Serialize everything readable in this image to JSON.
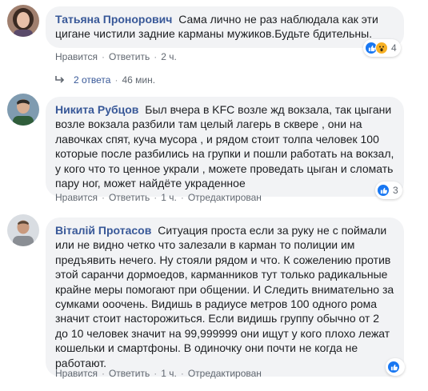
{
  "comments": [
    {
      "author": "Татьяна Пронорович",
      "text": "Сама лично не раз наблюдала как эти цигане чистили задние карманы мужиков.Будьте бдительны.",
      "like_label": "Нравится",
      "reply_label": "Ответить",
      "time": "2 ч.",
      "edited_label": "",
      "reaction_count": "4",
      "reaction_icons": [
        "like-icon",
        "wow-icon"
      ]
    },
    {
      "author": "Никита Рубцов",
      "text": "Был вчера в KFC возле жд вокзала, так цыгани возле вокзала разбили там целый лагерь в сквере , они на лавочках спят, куча мусора , и рядом стоит толпа человек 100 которые после разбились на групки и пошли работать на вокзал, у кого что то ценное украли , можете проведать цыган и сломать пару ног, может найдёте украденное",
      "like_label": "Нравится",
      "reply_label": "Ответить",
      "time": "1 ч.",
      "edited_label": "Отредактирован",
      "reaction_count": "3",
      "reaction_icons": [
        "like-icon"
      ]
    },
    {
      "author": "Віталій Протасов",
      "text": "Ситуация проста если за руку не с поймали или не видно четко что залезали в карман то полиции им предъявить нечего. Ну стояли рядом и что. К сожелению против этой саранчи дормоедов, карманников тут только радикальные крайне меры помогают при общении. И Следить внимательно за сумками ооочень. Видишь в радиусе метров 100 одного рома значит стоит насторожиться. Если видишь группу обычно от 2 до 10 человек значит на 99,999999 они ищут у кого плохо лежат кошельки и смартфоны. В одиночку они почти не когда не работают.",
      "like_label": "Нравится",
      "reply_label": "Ответить",
      "time": "1 ч.",
      "edited_label": "Отредактирован",
      "reaction_count": "",
      "reaction_icons": [
        "like-icon"
      ]
    }
  ],
  "replies_link": {
    "icon": "reply-arrow-icon",
    "label": "2 ответа",
    "time": "46 мин."
  },
  "colors": {
    "author": "#385898",
    "bubble_bg": "#f2f3f5",
    "meta": "#606770",
    "like_blue": "#1877f2",
    "wow_yellow": "#f7b125"
  }
}
